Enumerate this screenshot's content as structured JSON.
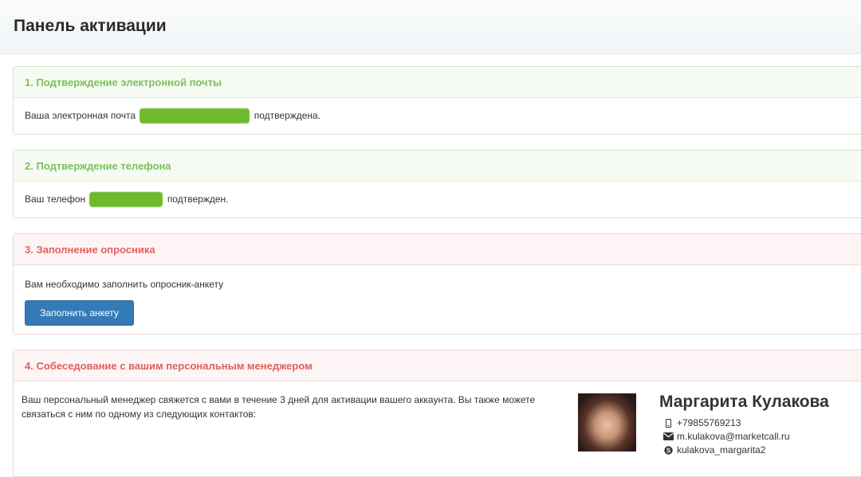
{
  "page": {
    "title": "Панель активации"
  },
  "steps": [
    {
      "heading": "1. Подтверждение электронной почты",
      "text_before": "Ваша электронная почта",
      "text_after": "подтверждена."
    },
    {
      "heading": "2. Подтверждение телефона",
      "text_before": "Ваш телефон",
      "text_after": "подтвержден."
    },
    {
      "heading": "3. Заполнение опросника",
      "text": "Вам необходимо заполнить опросник-анкету",
      "button_label": "Заполнить анкету"
    },
    {
      "heading": "4. Собеседование с вашим персональным менеджером",
      "text": "Ваш персональный менеджер свяжется с вами в течение 3 дней для активации вашего аккаунта. Вы также можете связаться с ним по одному из следующих контактов:"
    }
  ],
  "manager": {
    "name": "Маргарита Кулакова",
    "phone": "+79855769213",
    "email": "m.kulakova@marketcall.ru",
    "skype": "kulakova_margarita2"
  },
  "colors": {
    "success_heading": "#7cc15a",
    "danger_heading": "#e0605d",
    "primary_button": "#337ab7",
    "redaction": "#6fba2c"
  },
  "icons": [
    "mobile-phone-icon",
    "envelope-icon",
    "skype-icon"
  ]
}
